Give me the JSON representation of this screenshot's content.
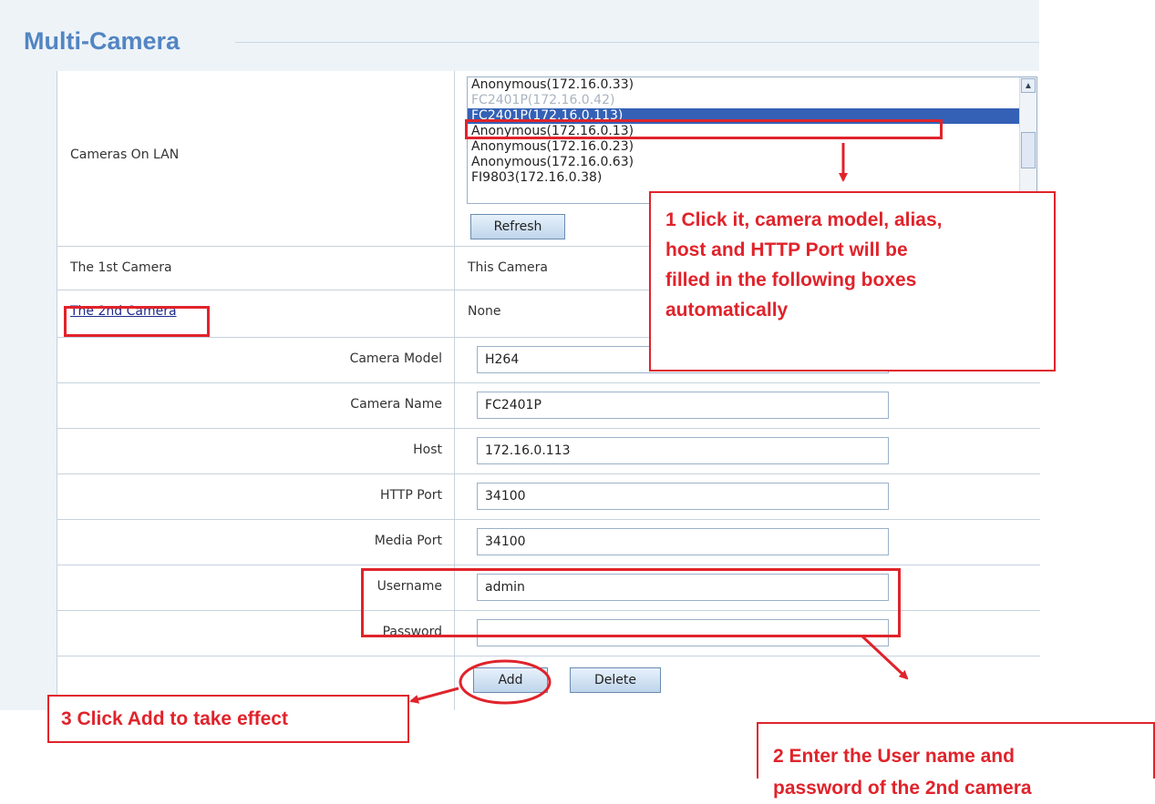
{
  "page_title": "Multi-Camera",
  "cameras_on_lan": {
    "label": "Cameras On LAN",
    "items": [
      "Anonymous(172.16.0.33)",
      "FC2401P(172.16.0.42)",
      "FC2401P(172.16.0.113)",
      "Anonymous(172.16.0.13)",
      "Anonymous(172.16.0.23)",
      " Anonymous(172.16.0.63)",
      "FI9803(172.16.0.38)"
    ],
    "selected_item": "FC2401P(172.16.0.113)",
    "refresh_label": "Refresh"
  },
  "first_camera": {
    "label": "The 1st Camera",
    "value": "This Camera"
  },
  "second_camera": {
    "label": "The 2nd Camera",
    "value": "None"
  },
  "fields": {
    "camera_model": {
      "label": "Camera Model",
      "value": "H264"
    },
    "camera_name": {
      "label": "Camera Name",
      "value": "FC2401P"
    },
    "host": {
      "label": "Host",
      "value": "172.16.0.113"
    },
    "http_port": {
      "label": "HTTP Port",
      "value": "34100"
    },
    "media_port": {
      "label": "Media Port",
      "value": "34100"
    },
    "username": {
      "label": "Username",
      "value": "admin"
    },
    "password": {
      "label": "Password",
      "value": ""
    }
  },
  "buttons": {
    "add": "Add",
    "delete": "Delete"
  },
  "annotations": {
    "step1": [
      "1 Click it, camera model, alias,",
      "host and HTTP Port will be",
      "filled in the following boxes",
      "automatically"
    ],
    "step2": [
      "2 Enter the User name and",
      "password of the 2nd camera"
    ],
    "step3": "3 Click Add to take effect"
  },
  "colors": {
    "annotation_red": "#e0232b",
    "title_blue": "#5285c2",
    "selection_blue": "#3461b6"
  }
}
